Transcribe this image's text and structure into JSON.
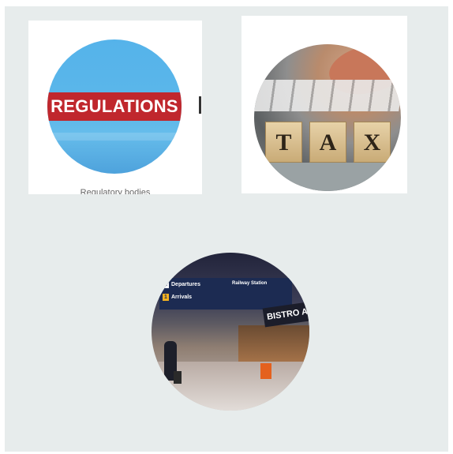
{
  "cards": {
    "regulations": {
      "banner_text": "REGULATIONS",
      "caption": "Regulatory bodies"
    },
    "tax": {
      "blocks": [
        "T",
        "A",
        "X"
      ]
    },
    "airport": {
      "departures": "Departures",
      "departures_num": "1",
      "arrivals": "Arrivals",
      "arrivals_num": "1",
      "railway": "Railway Station",
      "bistro": "BISTRO AIRPO"
    }
  },
  "colors": {
    "background": "#e7ecec",
    "card": "#ffffff",
    "regulations_band": "#c0272d",
    "regulations_sky": "#55b3ea"
  }
}
